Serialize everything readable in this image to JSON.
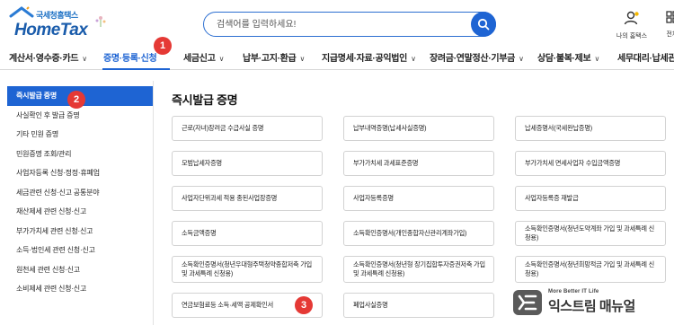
{
  "header": {
    "logo_sub": "국세청홈택스",
    "logo_main": "HomeTax",
    "search_placeholder": "검색어를 입력하세요!",
    "user_menu_label": "나의 홈택스",
    "all_menu_label": "전체"
  },
  "nav": {
    "items": [
      {
        "label": "계산서·영수증·카드"
      },
      {
        "label": "증명·등록·신청"
      },
      {
        "label": "세금신고"
      },
      {
        "label": "납부·고지·환급"
      },
      {
        "label": "지급명세·자료·공익법인"
      },
      {
        "label": "장려금·연말정산·기부금"
      },
      {
        "label": "상담·불복·제보"
      },
      {
        "label": "세무대리·납세관리"
      }
    ],
    "active_index": 1
  },
  "sidebar": {
    "items": [
      {
        "label": "즉시발급 증명"
      },
      {
        "label": "사실확인 후 발급 증명"
      },
      {
        "label": "기타 민원 증명"
      },
      {
        "label": "민원증명 조회/관리"
      },
      {
        "label": "사업자등록 신청·정정·휴폐업"
      },
      {
        "label": "세금관련 신청·신고 공통분야"
      },
      {
        "label": "재산제세 관련 신청·신고"
      },
      {
        "label": "부가가치세 관련 신청·신고"
      },
      {
        "label": "소득·법인세 관련 신청·신고"
      },
      {
        "label": "원천세 관련 신청·신고"
      },
      {
        "label": "소비제세 관련 신청·신고"
      }
    ],
    "active_index": 0
  },
  "main": {
    "title": "즉시발급 증명",
    "cards": [
      {
        "label": "근로(자녀)장려금 수급사실 증명"
      },
      {
        "label": "납부내역증명(납세사실증명)"
      },
      {
        "label": "납세증명서(국세완납증명)"
      },
      {
        "label": "모범납세자증명"
      },
      {
        "label": "부가가치세 과세표준증명"
      },
      {
        "label": "부가가치세 면세사업자 수입금액증명"
      },
      {
        "label": "사업자단위과세 적용 종된사업장증명"
      },
      {
        "label": "사업자등록증명"
      },
      {
        "label": "사업자등록증 재발급"
      },
      {
        "label": "소득금액증명"
      },
      {
        "label": "소득확인증명서(개인종합자산관리계좌가입)"
      },
      {
        "label": "소득확인증명서(청년도약계좌 가입 및 과세특례 신청용)"
      },
      {
        "label": "소득확인증명서(청년우대형주택청약종합저축 가입 및 과세특례 신청용)"
      },
      {
        "label": "소득확인증명서(청년형 장기집합투자증권저축 가입 및 과세특례 신청용)"
      },
      {
        "label": "소득확인증명서(청년희망적금 가입 및 과세특례 신청용)"
      },
      {
        "label": "연금보험료등 소득·세액 공제확인서"
      },
      {
        "label": "폐업사실증명"
      }
    ]
  },
  "badges": [
    "1",
    "2",
    "3"
  ],
  "watermark": {
    "tagline": "More Better IT Life",
    "name": "익스트림 매뉴얼"
  },
  "colors": {
    "accent": "#1e64d3",
    "badge": "#e53935",
    "brand": "#1a5cab"
  }
}
